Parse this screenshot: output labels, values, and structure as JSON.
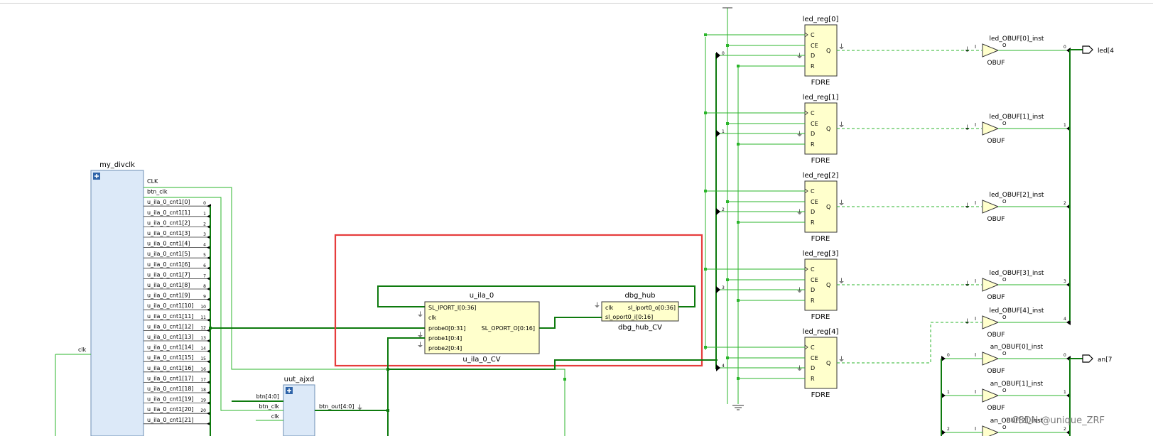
{
  "colors": {
    "wire": "#2bb52b",
    "wire_bold": "#0e7a0e",
    "block_fill": "#ffffcc",
    "hier_fill": "#dce9f8",
    "highlight": "#e63c3c",
    "port_mark": "#000000"
  },
  "my_divclk": {
    "title": "my_divclk",
    "icon": "plus-icon",
    "ports": [
      "CLK",
      "btn_clk",
      "u_ila_0_cnt1[0]",
      "u_ila_0_cnt1[1]",
      "u_ila_0_cnt1[2]",
      "u_ila_0_cnt1[3]",
      "u_ila_0_cnt1[4]",
      "u_ila_0_cnt1[5]",
      "u_ila_0_cnt1[6]",
      "u_ila_0_cnt1[7]",
      "u_ila_0_cnt1[8]",
      "u_ila_0_cnt1[9]",
      "u_ila_0_cnt1[10]",
      "u_ila_0_cnt1[11]",
      "u_ila_0_cnt1[12]",
      "u_ila_0_cnt1[13]",
      "u_ila_0_cnt1[14]",
      "u_ila_0_cnt1[15]",
      "u_ila_0_cnt1[16]",
      "u_ila_0_cnt1[17]",
      "u_ila_0_cnt1[18]",
      "u_ila_0_cnt1[19]",
      "u_ila_0_cnt1[20]",
      "u_ila_0_cnt1[21]"
    ],
    "bit_indices": [
      "0",
      "1",
      "2",
      "3",
      "4",
      "5",
      "6",
      "7",
      "8",
      "9",
      "10",
      "11",
      "12",
      "13",
      "14",
      "15",
      "16",
      "17",
      "18",
      "19",
      "20"
    ],
    "input_label": "clk"
  },
  "uut_ajxd": {
    "title": "uut_ajxd",
    "icon": "plus-icon",
    "inputs": [
      "btn[4:0]",
      "btn_clk",
      "clk"
    ],
    "output": "btn_out[4:0]"
  },
  "u_ila_0": {
    "title": "u_ila_0",
    "subtitle": "u_ila_0_CV",
    "pins": [
      "SL_IPORT_I[0:36]",
      "clk",
      "probe0[0:31]",
      "probe1[0:4]",
      "probe2[0:4]"
    ],
    "output_pin": "SL_OPORT_O[0:16]"
  },
  "dbg_hub": {
    "title": "dbg_hub",
    "subtitle": "dbg_hub_CV",
    "pins": [
      "clk",
      "sl_oport0_i[0:16]"
    ],
    "output_pin": "sl_iport0_o[0:36]"
  },
  "fdre_pins": [
    "C",
    "CE",
    "D",
    "R"
  ],
  "fdre_q": "Q",
  "fdre_type": "FDRE",
  "led_regs": [
    "led_reg[0]",
    "led_reg[1]",
    "led_reg[2]",
    "led_reg[3]",
    "led_reg[4]"
  ],
  "led_obufs": [
    "led_OBUF[0]_inst",
    "led_OBUF[1]_inst",
    "led_OBUF[2]_inst",
    "led_OBUF[3]_inst",
    "led_OBUF[4]_inst"
  ],
  "an_obufs": [
    "an_OBUF[0]_inst",
    "an_OBUF[1]_inst",
    "an_OBUF[2]_inst"
  ],
  "obuf_type": "OBUF",
  "obuf_in": "I",
  "obuf_out": "O",
  "bus_bits": [
    "0",
    "1",
    "2",
    "3",
    "4"
  ],
  "output_ports": [
    "led[4",
    "an[7"
  ],
  "watermark": "CSDN @unique_ZRF"
}
